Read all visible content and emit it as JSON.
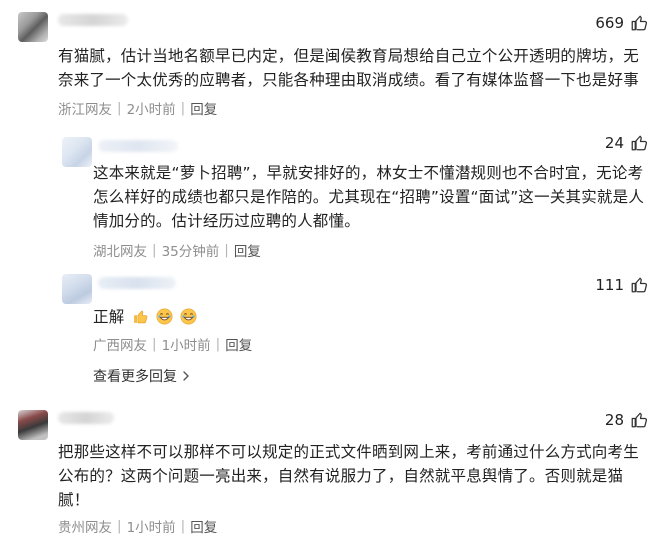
{
  "comments": [
    {
      "likes": "669",
      "text_lines": [
        "有猫腻，估计当地名额早已内定，但是闽侯教育局想给自己立个公开透明的牌坊，无",
        "奈来了一个太优秀的应聘者，只能各种理由取消成绩。看了有媒体监督一下也是好事"
      ],
      "location": "浙江网友",
      "time": "2小时前",
      "reply": "回复"
    },
    {
      "likes": "24",
      "text_lines": [
        "这本来就是“萝卜招聘”，早就安排好的，林女士不懂潜规则也不合时宜，无论考",
        "怎么样好的成绩也都只是作陪的。尤其现在“招聘”设置“面试”这一关其实就是人",
        "情加分的。估计经历过应聘的人都懂。"
      ],
      "location": "湖北网友",
      "time": "35分钟前",
      "reply": "回复"
    },
    {
      "likes": "111",
      "text_lines": [
        "正解"
      ],
      "location": "广西网友",
      "time": "1小时前",
      "reply": "回复"
    },
    {
      "likes": "28",
      "text_lines": [
        "把那些这样不可以那样不可以规定的正式文件晒到网上来，考前通过什么方式向考生",
        "公布的？这两个问题一亮出来，自然有说服力了，自然就平息舆情了。否则就是猫",
        "腻！"
      ],
      "location": "贵州网友",
      "time": "1小时前",
      "reply": "回复"
    }
  ],
  "more_replies": "查看更多回复",
  "icons": {
    "like": "thumbs-up-icon",
    "emoji_thumb": "thumbs-up-emoji-icon",
    "emoji_laugh": "laughing-emoji-icon",
    "chevron": "chevron-right-icon"
  }
}
